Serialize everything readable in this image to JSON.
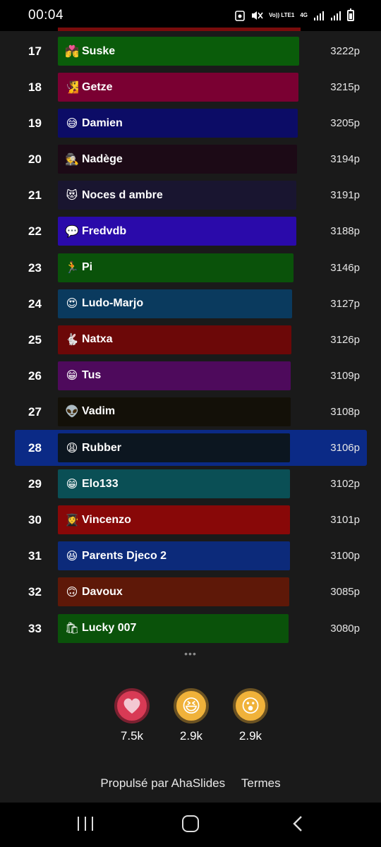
{
  "status": {
    "time": "00:04",
    "net": "4G",
    "volte": "Vo)) LTE1"
  },
  "leaderboard": [
    {
      "rank": "17",
      "emoji": "💏",
      "name": "Suske",
      "score": "3222p",
      "color": "#0a5c0a"
    },
    {
      "rank": "18",
      "emoji": "🧏",
      "name": "Getze",
      "score": "3215p",
      "color": "#7a0032"
    },
    {
      "rank": "19",
      "emoji": "😅",
      "name": "Damien",
      "score": "3205p",
      "color": "#0c0c66"
    },
    {
      "rank": "20",
      "emoji": "🕵",
      "name": "Nadège",
      "score": "3194p",
      "color": "#1c0a16"
    },
    {
      "rank": "21",
      "emoji": "😻",
      "name": "Noces d ambre",
      "score": "3191p",
      "color": "#191530"
    },
    {
      "rank": "22",
      "emoji": "💬",
      "name": "Fredvdb",
      "score": "3188p",
      "color": "#2a0aaa"
    },
    {
      "rank": "23",
      "emoji": "🏃",
      "name": "Pi",
      "score": "3146p",
      "color": "#0a520a"
    },
    {
      "rank": "24",
      "emoji": "😍",
      "name": "Ludo-Marjo",
      "score": "3127p",
      "color": "#0a3a5e"
    },
    {
      "rank": "25",
      "emoji": "🐇",
      "name": "Natxa",
      "score": "3126p",
      "color": "#6c0808"
    },
    {
      "rank": "26",
      "emoji": "😁",
      "name": "Tus",
      "score": "3109p",
      "color": "#4e0a5c"
    },
    {
      "rank": "27",
      "emoji": "👽",
      "name": "Vadim",
      "score": "3108p",
      "color": "#131008"
    },
    {
      "rank": "28",
      "emoji": "😩",
      "name": "Rubber",
      "score": "3106p",
      "color": "#0c1620",
      "highlight": true
    },
    {
      "rank": "29",
      "emoji": "😁",
      "name": "Elo133",
      "score": "3102p",
      "color": "#0a4f55"
    },
    {
      "rank": "30",
      "emoji": "👩‍🎓",
      "name": "Vincenzo",
      "score": "3101p",
      "color": "#880808"
    },
    {
      "rank": "31",
      "emoji": "😆",
      "name": "Parents Djeco 2",
      "score": "3100p",
      "color": "#0c2a7a"
    },
    {
      "rank": "32",
      "emoji": "🙃",
      "name": "Davoux",
      "score": "3085p",
      "color": "#5e1808"
    },
    {
      "rank": "33",
      "emoji": "🛍",
      "name": "Lucky 007",
      "score": "3080p",
      "color": "#0a520a"
    }
  ],
  "more_indicator": "•••",
  "reactions": [
    {
      "icon": "heart-icon",
      "glyph": "❤",
      "count": "7.5k"
    },
    {
      "icon": "laughing-face-icon",
      "glyph": "😆",
      "count": "2.9k"
    },
    {
      "icon": "surprised-face-icon",
      "glyph": "😮",
      "count": "2.9k"
    }
  ],
  "footer": {
    "powered": "Propulsé par AhaSlides",
    "terms": "Termes"
  }
}
